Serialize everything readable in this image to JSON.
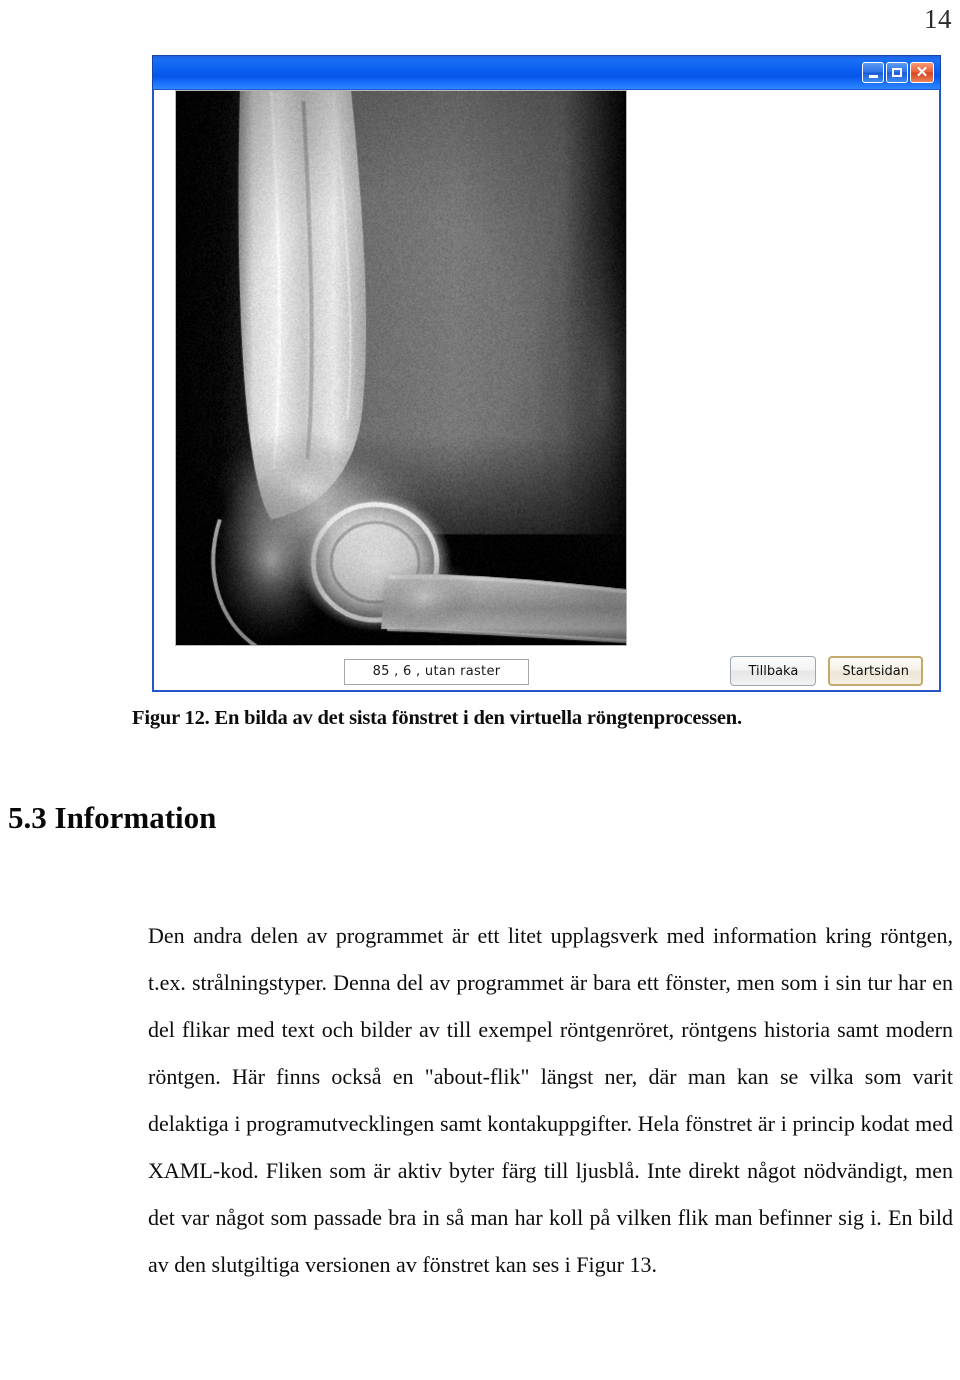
{
  "document": {
    "page_number": "14",
    "figure_caption": "Figur 12. En bilda av det sista fönstret i den virtuella röngtenprocessen.",
    "section_heading": "5.3 Information",
    "body_paragraph": "Den andra delen av programmet är ett litet upplagsverk med information kring röntgen, t.ex. strålningstyper. Denna del av programmet är bara ett fönster, men som i sin tur har en del flikar med text och bilder av till exempel röntgenröret, röntgens historia samt modern röntgen. Här finns också en \"about-flik\" längst ner, där man kan se vilka som varit delaktiga i programutvecklingen samt kontakuppgifter. Hela fönstret är i princip kodat med XAML-kod. Fliken som är aktiv byter färg till ljusblå. Inte direkt något nödvändigt, men det var något som passade bra in så man har koll på vilken flik man befinner sig i.  En bild av den slutgiltiga versionen av fönstret kan ses i Figur 13."
  },
  "app_window": {
    "title": "",
    "titlebar_color": "#0a5ef0",
    "border_color": "#2356c8",
    "window_buttons": [
      {
        "name": "minimize",
        "glyph": "_"
      },
      {
        "name": "maximize",
        "glyph": "□"
      },
      {
        "name": "close",
        "glyph": "✕"
      }
    ],
    "xray_image": {
      "alt": "lateral elbow radiograph",
      "background": "#000000"
    },
    "value_field": {
      "value": "85 , 6 , utan raster",
      "placeholder": ""
    },
    "buttons": [
      {
        "label": "Tillbaka",
        "state": "normal"
      },
      {
        "label": "Startsidan",
        "state": "focused"
      }
    ]
  }
}
